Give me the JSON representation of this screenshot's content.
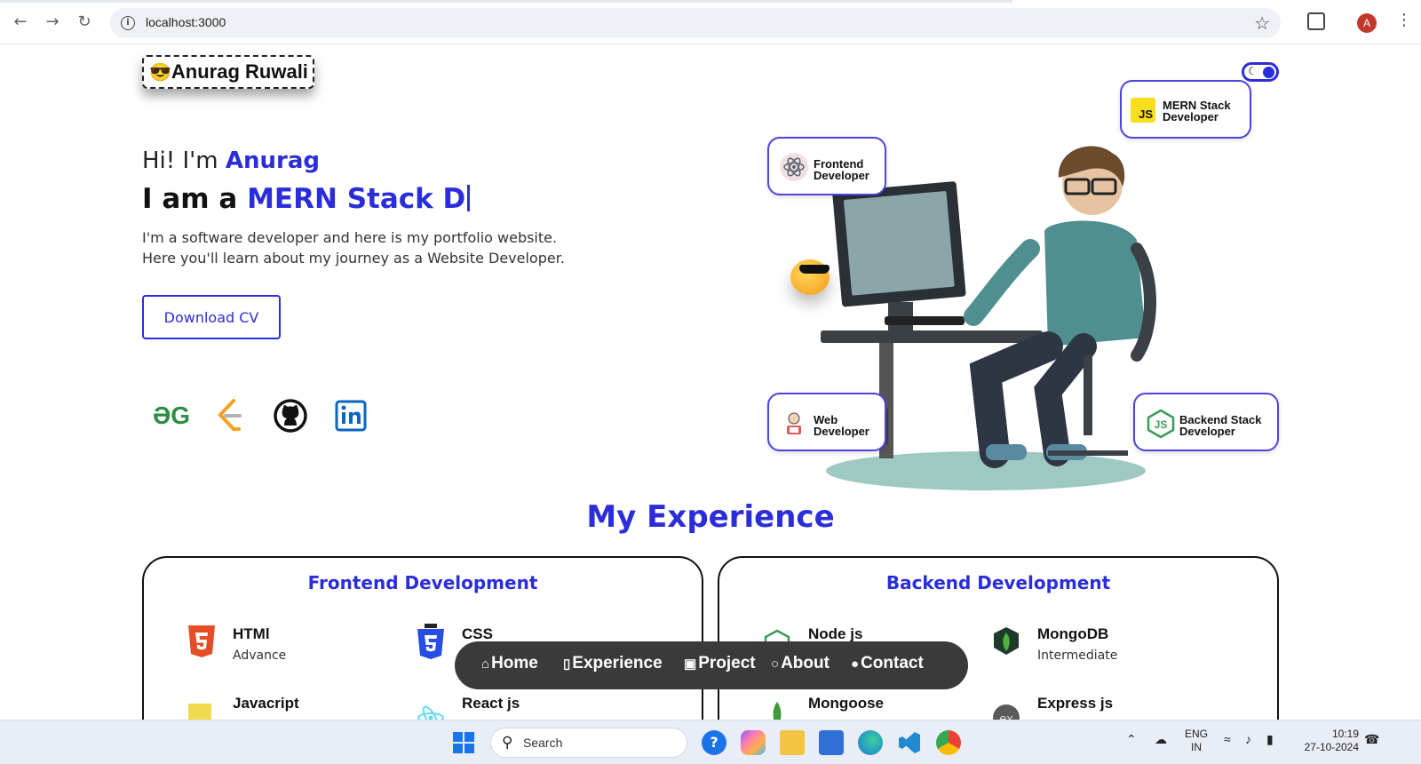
{
  "browser": {
    "url": "localhost:3000",
    "avatar_letter": "A"
  },
  "header": {
    "logo_emoji": "😎",
    "logo_text": "Anurag Ruwali",
    "theme_toggle_icon": "moon-icon"
  },
  "hero": {
    "greeting_prefix": "Hi! I'm ",
    "greeting_name": "Anurag",
    "iam_prefix": "I am a ",
    "iam_typed": "MERN Stack D",
    "desc_line1": "I'm a software developer and here is my portfolio website.",
    "desc_line2": "Here you'll learn about my journey as a Website Developer.",
    "cv_button": "Download CV",
    "social": [
      "geeksforgeeks-icon",
      "leetcode-icon",
      "github-icon",
      "linkedin-icon"
    ]
  },
  "badges": {
    "mern": {
      "line1": "MERN Stack",
      "line2": "Developer",
      "icon": "JS"
    },
    "frontend": {
      "line1": "Frontend",
      "line2": "Developer"
    },
    "web": {
      "line1": "Web",
      "line2": "Developer"
    },
    "backend": {
      "line1": "Backend Stack",
      "line2": "Developer",
      "icon": "JS"
    }
  },
  "experience": {
    "title": "My Experience",
    "frontend": {
      "title": "Frontend Development",
      "skills": [
        {
          "name": "HTMl",
          "level": "Advance"
        },
        {
          "name": "CSS",
          "level": ""
        },
        {
          "name": "Javacript",
          "level": ""
        },
        {
          "name": "React js",
          "level": ""
        }
      ]
    },
    "backend": {
      "title": "Backend Development",
      "skills": [
        {
          "name": "Node js",
          "level": ""
        },
        {
          "name": "MongoDB",
          "level": "Intermediate"
        },
        {
          "name": "Mongoose",
          "level": ""
        },
        {
          "name": "Express js",
          "level": ""
        }
      ]
    }
  },
  "floating_nav": [
    "Home",
    "Experience",
    "Project",
    "About",
    "Contact"
  ],
  "taskbar": {
    "search_placeholder": "Search",
    "lang_line1": "ENG",
    "lang_line2": "IN",
    "time": "10:19",
    "date": "27-10-2024"
  },
  "colors": {
    "accent": "#2b2ed8",
    "nav_bg": "#3a3a3a"
  }
}
